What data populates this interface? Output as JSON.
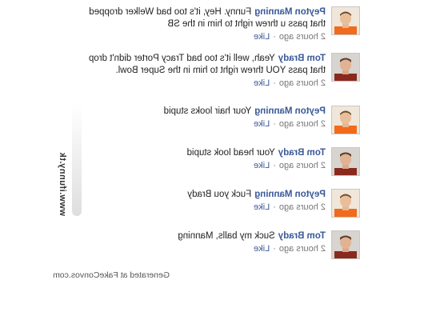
{
  "comments": [
    {
      "author": "Peyton Manning",
      "text": "Funny. Hey, it's too bad Welker dropped that pass u threw right to him in the SB",
      "time": "2 hours ago",
      "like": "Like",
      "avatar": "peyton-manning-avatar"
    },
    {
      "author": "Tom Brady",
      "text": "Yeah, well it's too bad Tracy Porter didn't drop that pass YOU threw right to him in the Super Bowl.",
      "time": "2 hours ago",
      "like": "Like",
      "avatar": "tom-brady-avatar"
    },
    {
      "author": "Peyton Manning",
      "text": "Your hair looks stupid",
      "time": "2 hours ago",
      "like": "Like",
      "avatar": "peyton-manning-avatar"
    },
    {
      "author": "Tom Brady",
      "text": "Your head look stupid",
      "time": "2 hours ago",
      "like": "Like",
      "avatar": "tom-brady-avatar"
    },
    {
      "author": "Peyton Manning",
      "text": "Fuck you Brady",
      "time": "2 hours ago",
      "like": "Like",
      "avatar": "peyton-manning-avatar"
    },
    {
      "author": "Tom Brady",
      "text": "Suck my balls, Manning",
      "time": "2 hours ago",
      "like": "Like",
      "avatar": "tom-brady-avatar"
    }
  ],
  "separator": "·",
  "watermark": "www.ifunny.tk",
  "footer": "Generated at FakeConvos.com",
  "colors": {
    "author": "#3b5998",
    "like": "#3b5998",
    "meta": "#777777",
    "peyton_jersey": "#f26a1b",
    "brady_jersey": "#8a2a1e"
  }
}
